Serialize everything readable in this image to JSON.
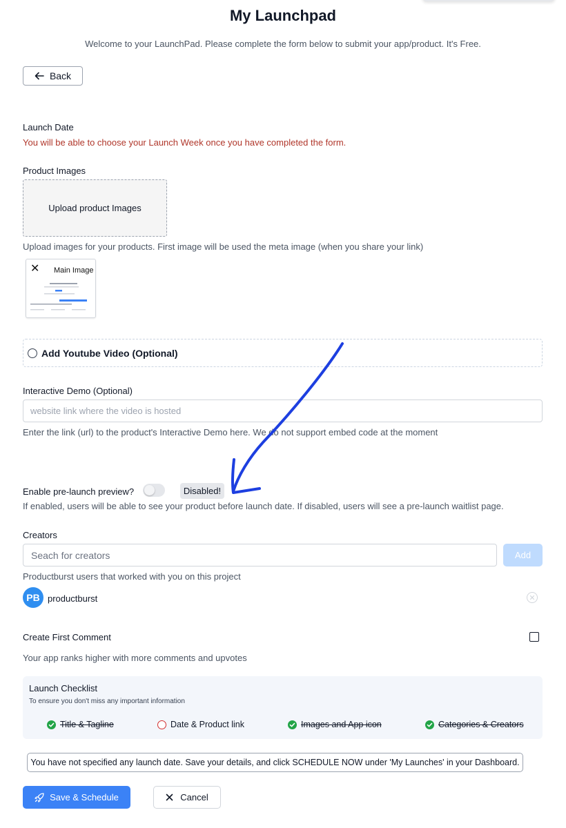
{
  "page": {
    "title": "My Launchpad",
    "subtitle": "Welcome to your LaunchPad. Please complete the form below to submit your app/product. It's Free."
  },
  "back_button": {
    "label": "Back",
    "icon": "arrow-left-icon"
  },
  "launch_date": {
    "label": "Launch Date",
    "notice": "You will be able to choose your Launch Week once you have completed the form."
  },
  "product_images": {
    "label": "Product Images",
    "upload_text": "Upload product Images",
    "help": "Upload images for your products. First image will be used the meta image (when you share your link)",
    "thumbnail_label": "Main Image"
  },
  "youtube": {
    "label": "Add Youtube Video (Optional)",
    "selected": false
  },
  "interactive_demo": {
    "label": "Interactive Demo (Optional)",
    "placeholder": "website link where the video is hosted",
    "value": "",
    "help": "Enter the link (url) to the product's Interactive Demo here. We do not support embed code at the moment"
  },
  "prelaunch": {
    "label": "Enable pre-launch preview?",
    "enabled": false,
    "status": "Disabled!",
    "help": "If enabled, users will be able to see your product before launch date. If disabled, users will see a pre-launch waitlist page."
  },
  "creators": {
    "label": "Creators",
    "search_placeholder": "Seach for creators",
    "add_label": "Add",
    "help": "Productburst users that worked with you on this project",
    "list": [
      {
        "initials": "PB",
        "name": "productburst"
      }
    ]
  },
  "first_comment": {
    "label": "Create First Comment",
    "checked": false,
    "help": "Your app ranks higher with more comments and upvotes"
  },
  "checklist": {
    "title": "Launch Checklist",
    "subtitle": "To ensure you don't miss any important information",
    "items": [
      {
        "label": "Title & Tagline",
        "done": true
      },
      {
        "label": "Date & Product link",
        "done": false
      },
      {
        "label": "Images and App icon",
        "done": true
      },
      {
        "label": "Categories & Creators",
        "done": true
      }
    ]
  },
  "schedule_notice": "You have not specified any launch date. Save your details, and click SCHEDULE NOW under 'My Launches' in your Dashboard.",
  "actions": {
    "save_label": "Save & Schedule",
    "save_icon": "rocket-icon",
    "cancel_label": "Cancel",
    "cancel_icon": "close-icon"
  },
  "colors": {
    "primary": "#3b82f6",
    "warning_text": "#b0362a",
    "check_done": "#22a447",
    "check_open": "#d32f2f",
    "annotation_arrow": "#1d3fe0",
    "avatar": "#2f8ef0"
  }
}
